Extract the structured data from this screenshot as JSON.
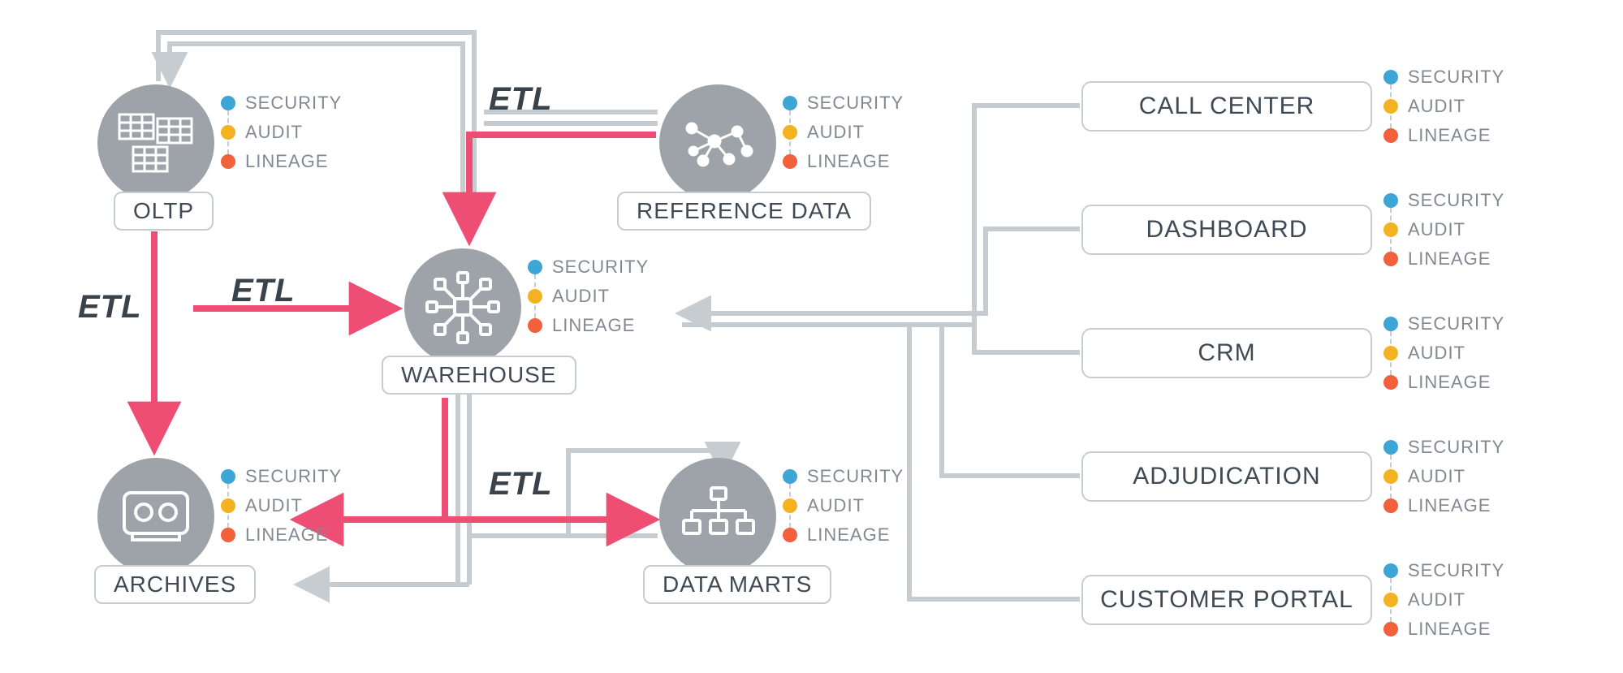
{
  "sal_labels": {
    "security": "SECURITY",
    "audit": "AUDIT",
    "lineage": "LINEAGE"
  },
  "etl_label": "ETL",
  "nodes": {
    "oltp": {
      "label": "OLTP"
    },
    "reference": {
      "label": "REFERENCE DATA"
    },
    "warehouse": {
      "label": "WAREHOUSE"
    },
    "archives": {
      "label": "ARCHIVES"
    },
    "datamarts": {
      "label": "DATA MARTS"
    }
  },
  "apps": {
    "call_center": {
      "label": "CALL CENTER"
    },
    "dashboard": {
      "label": "DASHBOARD"
    },
    "crm": {
      "label": "CRM"
    },
    "adjudication": {
      "label": "ADJUDICATION"
    },
    "customer_portal": {
      "label": "CUSTOMER PORTAL"
    }
  },
  "colors": {
    "flow_gray": "#c7ccd0",
    "flow_pink": "#ee4d74",
    "node_gray": "#9da3a8",
    "dot_security": "#3da6d6",
    "dot_audit": "#f4b223",
    "dot_lineage": "#f2603c"
  }
}
